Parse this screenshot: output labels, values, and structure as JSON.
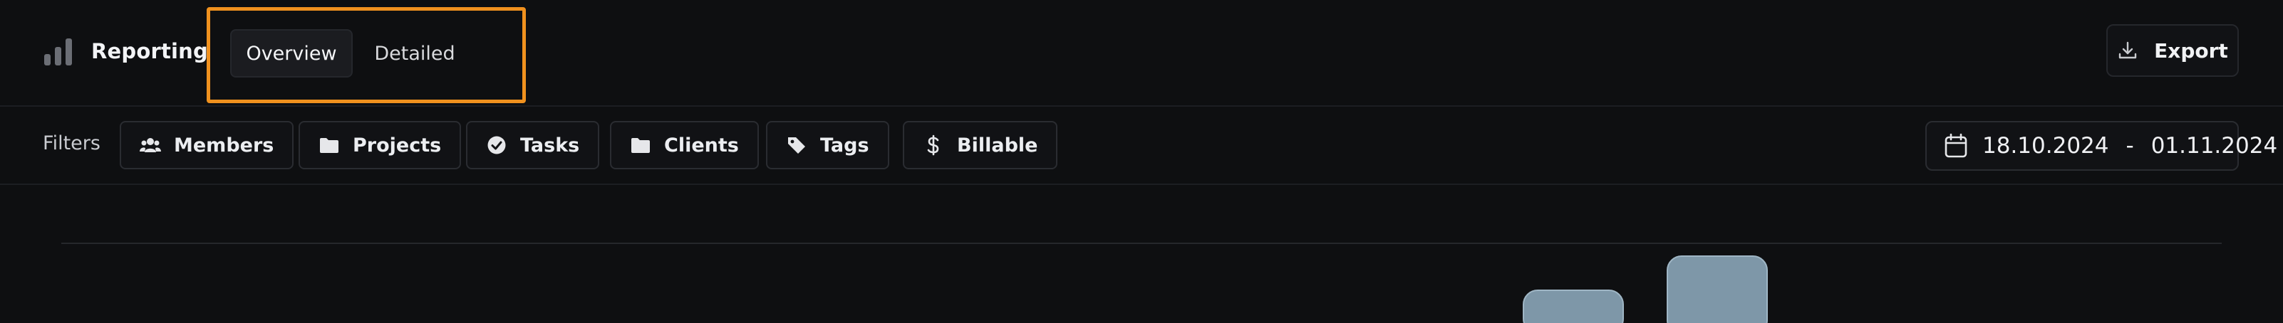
{
  "header": {
    "title": "Reporting",
    "brand_icon": "bar-chart-icon",
    "tabs": [
      {
        "label": "Overview",
        "active": true
      },
      {
        "label": "Detailed",
        "active": false
      }
    ],
    "export_label": "Export",
    "export_icon": "download-icon",
    "highlight_color": "#f0911e"
  },
  "filters": {
    "label": "Filters",
    "chips": [
      {
        "label": "Members",
        "icon": "users-icon"
      },
      {
        "label": "Projects",
        "icon": "folder-icon"
      },
      {
        "label": "Tasks",
        "icon": "check-circle-icon"
      },
      {
        "label": "Clients",
        "icon": "folder-icon"
      },
      {
        "label": "Tags",
        "icon": "tag-icon"
      },
      {
        "label": "Billable",
        "icon": "dollar-icon"
      }
    ],
    "date_from": "18.10.2024",
    "date_separator": "-",
    "date_to": "01.11.2024",
    "date_icon": "calendar-icon"
  },
  "chart": {
    "bar_color": "#7e97a8",
    "bar_border_color": "#9fb6c5",
    "gridline_color": "#25272b"
  }
}
